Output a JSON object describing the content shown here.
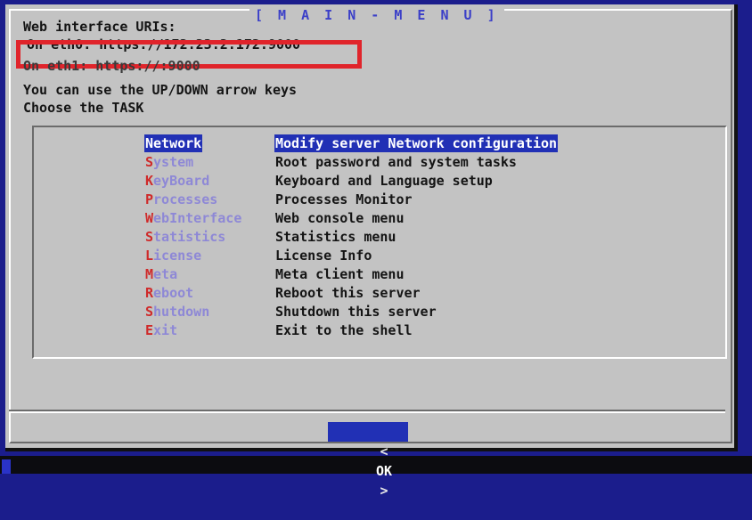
{
  "dialog": {
    "title": "[ M A I N - M E N U ]"
  },
  "info": {
    "line1": "Web interface URIs:",
    "eth0": "On eth0: https://172.23.2.172:9000",
    "eth1": "On eth1: https://:9000",
    "hint": "You can use the UP/DOWN arrow keys",
    "prompt": "Choose the TASK"
  },
  "menu": {
    "items": [
      {
        "hot": "N",
        "rest": "etwork",
        "desc": "Modify server Network configuration",
        "selected": true
      },
      {
        "hot": "S",
        "rest": "ystem",
        "desc": "Root password and system tasks"
      },
      {
        "hot": "K",
        "rest": "eyBoard",
        "desc": "Keyboard and Language setup"
      },
      {
        "hot": "P",
        "rest": "rocesses",
        "desc": "Processes Monitor"
      },
      {
        "hot": "W",
        "rest": "ebInterface",
        "desc": "Web console menu"
      },
      {
        "hot": "S",
        "rest": "tatistics",
        "desc": "Statistics menu"
      },
      {
        "hot": "L",
        "rest": "icense",
        "desc": "License Info"
      },
      {
        "hot": "M",
        "rest": "eta",
        "desc": "Meta client menu"
      },
      {
        "hot": "R",
        "rest": "eboot",
        "desc": "Reboot this server"
      },
      {
        "hot": "S",
        "rest": "hutdown",
        "desc": "Shutdown this server"
      },
      {
        "hot": "E",
        "rest": "xit",
        "desc": "Exit to the shell"
      }
    ]
  },
  "buttons": {
    "ok_left": "<",
    "ok_label": "OK",
    "ok_right": ">"
  },
  "colors": {
    "background": "#1b1d8c",
    "dialog": "#c3c3c3",
    "selection": "#2130b5",
    "hotkey": "#cf2a2a",
    "tag": "#8e88d6",
    "annotation": "#e0242b"
  }
}
